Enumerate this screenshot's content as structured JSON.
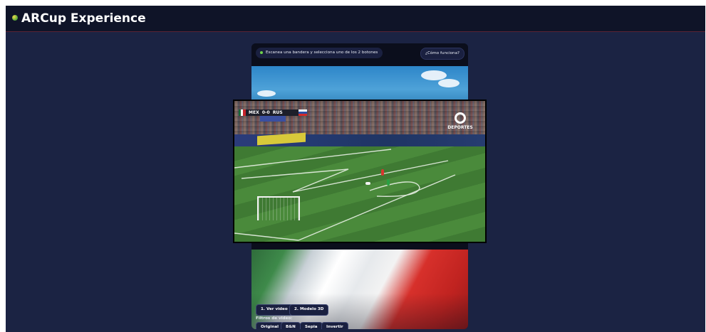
{
  "header": {
    "title": "ARCup Experience"
  },
  "phone": {
    "instruction": "Escanea una bandera y selecciona uno de los 2 botones",
    "help_button": "¿Cómo funciona?",
    "buttons": {
      "video": "1. Ver video",
      "model": "2. Modelo 3D"
    },
    "filters_label": "Filtros de video:",
    "filters": [
      "Original",
      "B&N",
      "Sepia",
      "Invertir"
    ]
  },
  "video": {
    "score_bug": "MEX  0-0  RUS",
    "broadcaster": "DEPORTES"
  },
  "colors": {
    "app_background": "#1b2343",
    "header_background": "#0f1428",
    "button_background": "#1a2040",
    "status_dot": "#6fd14a"
  },
  "icons": [
    "logo-dot-icon",
    "status-dot-icon"
  ]
}
